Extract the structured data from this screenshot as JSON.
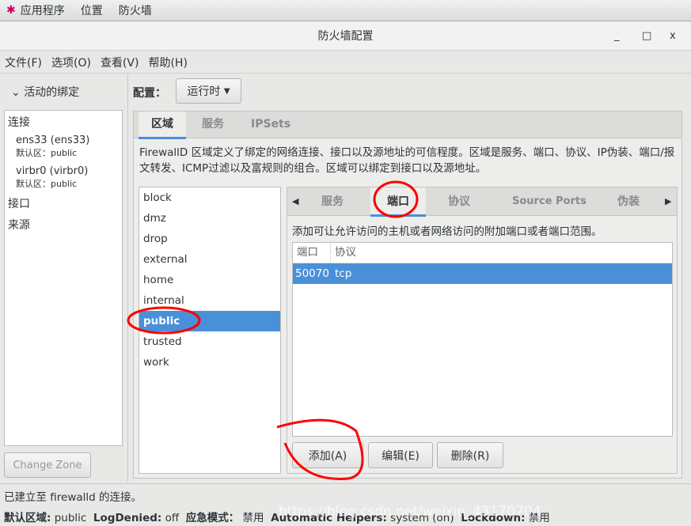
{
  "topbar": {
    "items": [
      "应用程序",
      "位置",
      "防火墙"
    ]
  },
  "window": {
    "title": "防火墙配置",
    "minimize": "_",
    "maximize": "□",
    "close": "x"
  },
  "menu": [
    "文件(F)",
    "选项(O)",
    "查看(V)",
    "帮助(H)"
  ],
  "left": {
    "header": "活动的绑定",
    "connections_label": "连接",
    "connections": [
      {
        "name": "ens33 (ens33)",
        "zone_label": "默认区：",
        "zone": "public"
      },
      {
        "name": "virbr0 (virbr0)",
        "zone_label": "默认区：",
        "zone": "public"
      }
    ],
    "interfaces_label": "接口",
    "sources_label": "来源",
    "change_zone": "Change Zone"
  },
  "config": {
    "label": "配置：",
    "value": "运行时"
  },
  "main_tabs": [
    "区域",
    "服务",
    "IPSets"
  ],
  "description": "FirewallD 区域定义了绑定的网络连接、接口以及源地址的可信程度。区域是服务、端口、协议、IP伪装、端口/报文转发、ICMP过滤以及富规则的组合。区域可以绑定到接口以及源地址。",
  "zones": [
    "block",
    "dmz",
    "drop",
    "external",
    "home",
    "internal",
    "public",
    "trusted",
    "work"
  ],
  "selected_zone": "public",
  "sub_tabs": [
    "服务",
    "端口",
    "协议",
    "Source Ports",
    "伪装"
  ],
  "active_sub_tab": "端口",
  "ports": {
    "description": "添加可让允许访问的主机或者网络访问的附加端口或者端口范围。",
    "columns": [
      "端口",
      "协议"
    ],
    "rows": [
      {
        "port": "50070",
        "protocol": "tcp"
      }
    ]
  },
  "buttons": {
    "add": "添加(A)",
    "edit": "编辑(E)",
    "remove": "删除(R)"
  },
  "status": {
    "connection": "已建立至  firewalld 的连接。",
    "default_zone_label": "默认区域:",
    "default_zone": "public",
    "logdenied_label": "LogDenied:",
    "logdenied": "off",
    "panic_label": "应急模式：",
    "panic": "禁用",
    "helpers_label": "Automatic Helpers:",
    "helpers": "system (on)",
    "lockdown_label": "Lockdown:",
    "lockdown": "禁用"
  },
  "watermark": "https://blog.csdn.net/weixin_43170704",
  "colors": {
    "selection": "#4a90d9",
    "annotation": "#ff0000"
  }
}
